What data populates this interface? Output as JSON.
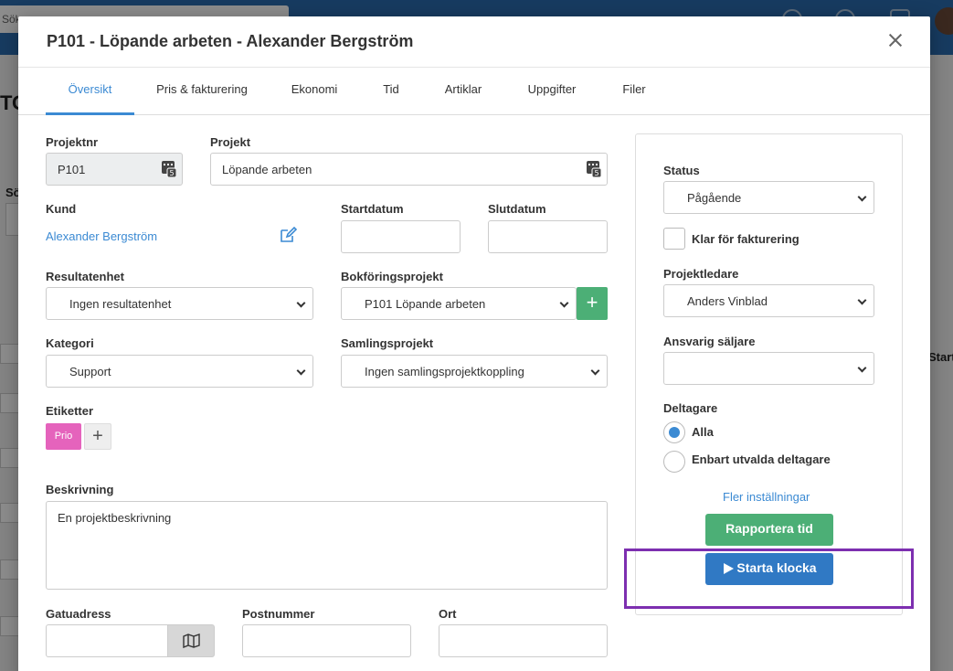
{
  "background": {
    "search_text": "Sök...",
    "left_text": "TO",
    "left_label": "Sö",
    "right_label": "Start"
  },
  "modal": {
    "title": "P101 - Löpande arbeten - Alexander Bergström"
  },
  "tabs": [
    {
      "label": "Översikt",
      "active": true
    },
    {
      "label": "Pris & fakturering"
    },
    {
      "label": "Ekonomi"
    },
    {
      "label": "Tid"
    },
    {
      "label": "Artiklar"
    },
    {
      "label": "Uppgifter"
    },
    {
      "label": "Filer"
    }
  ],
  "form": {
    "projektnr_label": "Projektnr",
    "projektnr_value": "P101",
    "projekt_label": "Projekt",
    "projekt_value": "Löpande arbeten",
    "kund_label": "Kund",
    "kund_value": "Alexander Bergström",
    "startdatum_label": "Startdatum",
    "startdatum_value": "",
    "slutdatum_label": "Slutdatum",
    "slutdatum_value": "",
    "resultatenhet_label": "Resultatenhet",
    "resultatenhet_value": "Ingen resultatenhet",
    "bokforingsprojekt_label": "Bokföringsprojekt",
    "bokforingsprojekt_value": "P101 Löpande arbeten",
    "kategori_label": "Kategori",
    "kategori_value": "Support",
    "samlingsprojekt_label": "Samlingsprojekt",
    "samlingsprojekt_value": "Ingen samlingsprojektkoppling",
    "etiketter_label": "Etiketter",
    "tag_label": "Prio",
    "tag_color": "#e563bc",
    "beskrivning_label": "Beskrivning",
    "beskrivning_value": "En projektbeskrivning",
    "gatuadress_label": "Gatuadress",
    "postnummer_label": "Postnummer",
    "ort_label": "Ort"
  },
  "panel": {
    "status_label": "Status",
    "status_value": "Pågående",
    "klar_label": "Klar för fakturering",
    "klar_checked": false,
    "projektledare_label": "Projektledare",
    "projektledare_value": "Anders Vinblad",
    "saljare_label": "Ansvarig säljare",
    "saljare_value": "",
    "deltagare_label": "Deltagare",
    "deltagare_options": [
      "Alla",
      "Enbart utvalda deltagare"
    ],
    "deltagare_selected": "Alla",
    "more_settings": "Fler inställningar",
    "report_time": "Rapportera tid",
    "start_clock": "Starta klocka"
  },
  "colors": {
    "accent": "#3b8ad3",
    "green": "#4caf76",
    "blue_button": "#3079c4",
    "highlight": "#7d2fb0"
  }
}
